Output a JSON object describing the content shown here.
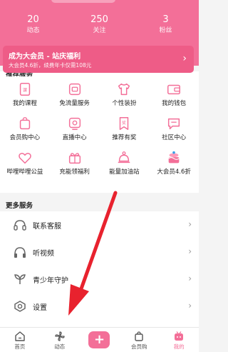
{
  "stats": [
    {
      "count": "20",
      "label": "动态"
    },
    {
      "count": "250",
      "label": "关注"
    },
    {
      "count": "3",
      "label": "粉丝"
    }
  ],
  "vip_banner": {
    "title": "成为大会员 - 站庆福利",
    "subtitle": "大会员4.6折，续费年卡仅需108元",
    "chevron": "›"
  },
  "recommended_services": {
    "title": "推荐服务",
    "items": [
      {
        "label": "我的课程",
        "icon": "course-icon"
      },
      {
        "label": "免流量服务",
        "icon": "free-data-icon"
      },
      {
        "label": "个性装扮",
        "icon": "tshirt-icon"
      },
      {
        "label": "我的钱包",
        "icon": "wallet-icon"
      },
      {
        "label": "会员购中心",
        "icon": "shopping-icon"
      },
      {
        "label": "直播中心",
        "icon": "live-icon"
      },
      {
        "label": "推荐有奖",
        "icon": "reward-icon"
      },
      {
        "label": "社区中心",
        "icon": "community-icon"
      },
      {
        "label": "哔哩哔哩公益",
        "icon": "charity-icon"
      },
      {
        "label": "充能领福利",
        "icon": "gift-icon"
      },
      {
        "label": "能量加油站",
        "icon": "energy-icon"
      },
      {
        "label": "大会员4.6折",
        "icon": "vip-cake-icon"
      }
    ]
  },
  "more_services": {
    "title": "更多服务",
    "items": [
      {
        "label": "联系客服",
        "icon": "headset-icon"
      },
      {
        "label": "听视频",
        "icon": "headphones-icon"
      },
      {
        "label": "青少年守护",
        "icon": "sprout-icon"
      },
      {
        "label": "设置",
        "icon": "settings-icon"
      }
    ],
    "chevron": "›"
  },
  "tabbar": [
    {
      "label": "首页",
      "icon": "home-icon"
    },
    {
      "label": "动态",
      "icon": "pinwheel-icon"
    },
    {
      "label": "+",
      "icon": "plus-icon"
    },
    {
      "label": "会员购",
      "icon": "bag-icon"
    },
    {
      "label": "我的",
      "icon": "tv-icon",
      "active": true
    }
  ],
  "colors": {
    "brand_pink": "#f36f98",
    "annotation_arrow": "#e8222e"
  }
}
